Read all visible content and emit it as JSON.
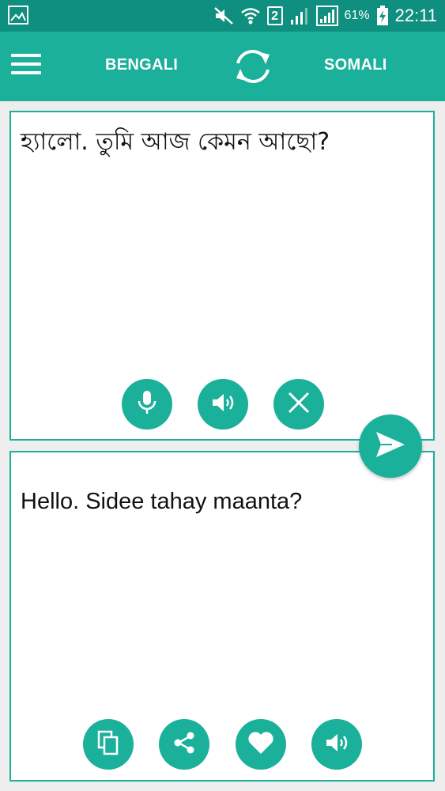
{
  "status_bar": {
    "battery_percent": "61%",
    "time": "22:11",
    "sim_slot": "2"
  },
  "app_bar": {
    "source_language": "BENGALI",
    "target_language": "SOMALI"
  },
  "source_panel": {
    "text": "হ্যালো. তুমি আজ কেমন আছো?"
  },
  "target_panel": {
    "text": "Hello. Sidee tahay maanta?"
  },
  "icons": {
    "status": [
      "image-icon",
      "mute-icon",
      "wifi-icon",
      "sim-icon",
      "signal-icon",
      "signal-icon",
      "battery-charging-icon"
    ],
    "app_bar": [
      "menu-icon",
      "swap-icon"
    ],
    "source_actions": [
      "microphone-icon",
      "speaker-icon",
      "close-icon"
    ],
    "translate": "send-icon",
    "target_actions": [
      "copy-icon",
      "share-icon",
      "heart-icon",
      "speaker-icon"
    ]
  },
  "colors": {
    "primary": "#1ab09a",
    "status_bar": "#0f8f7f",
    "background": "#eeeeee",
    "panel": "#ffffff"
  }
}
